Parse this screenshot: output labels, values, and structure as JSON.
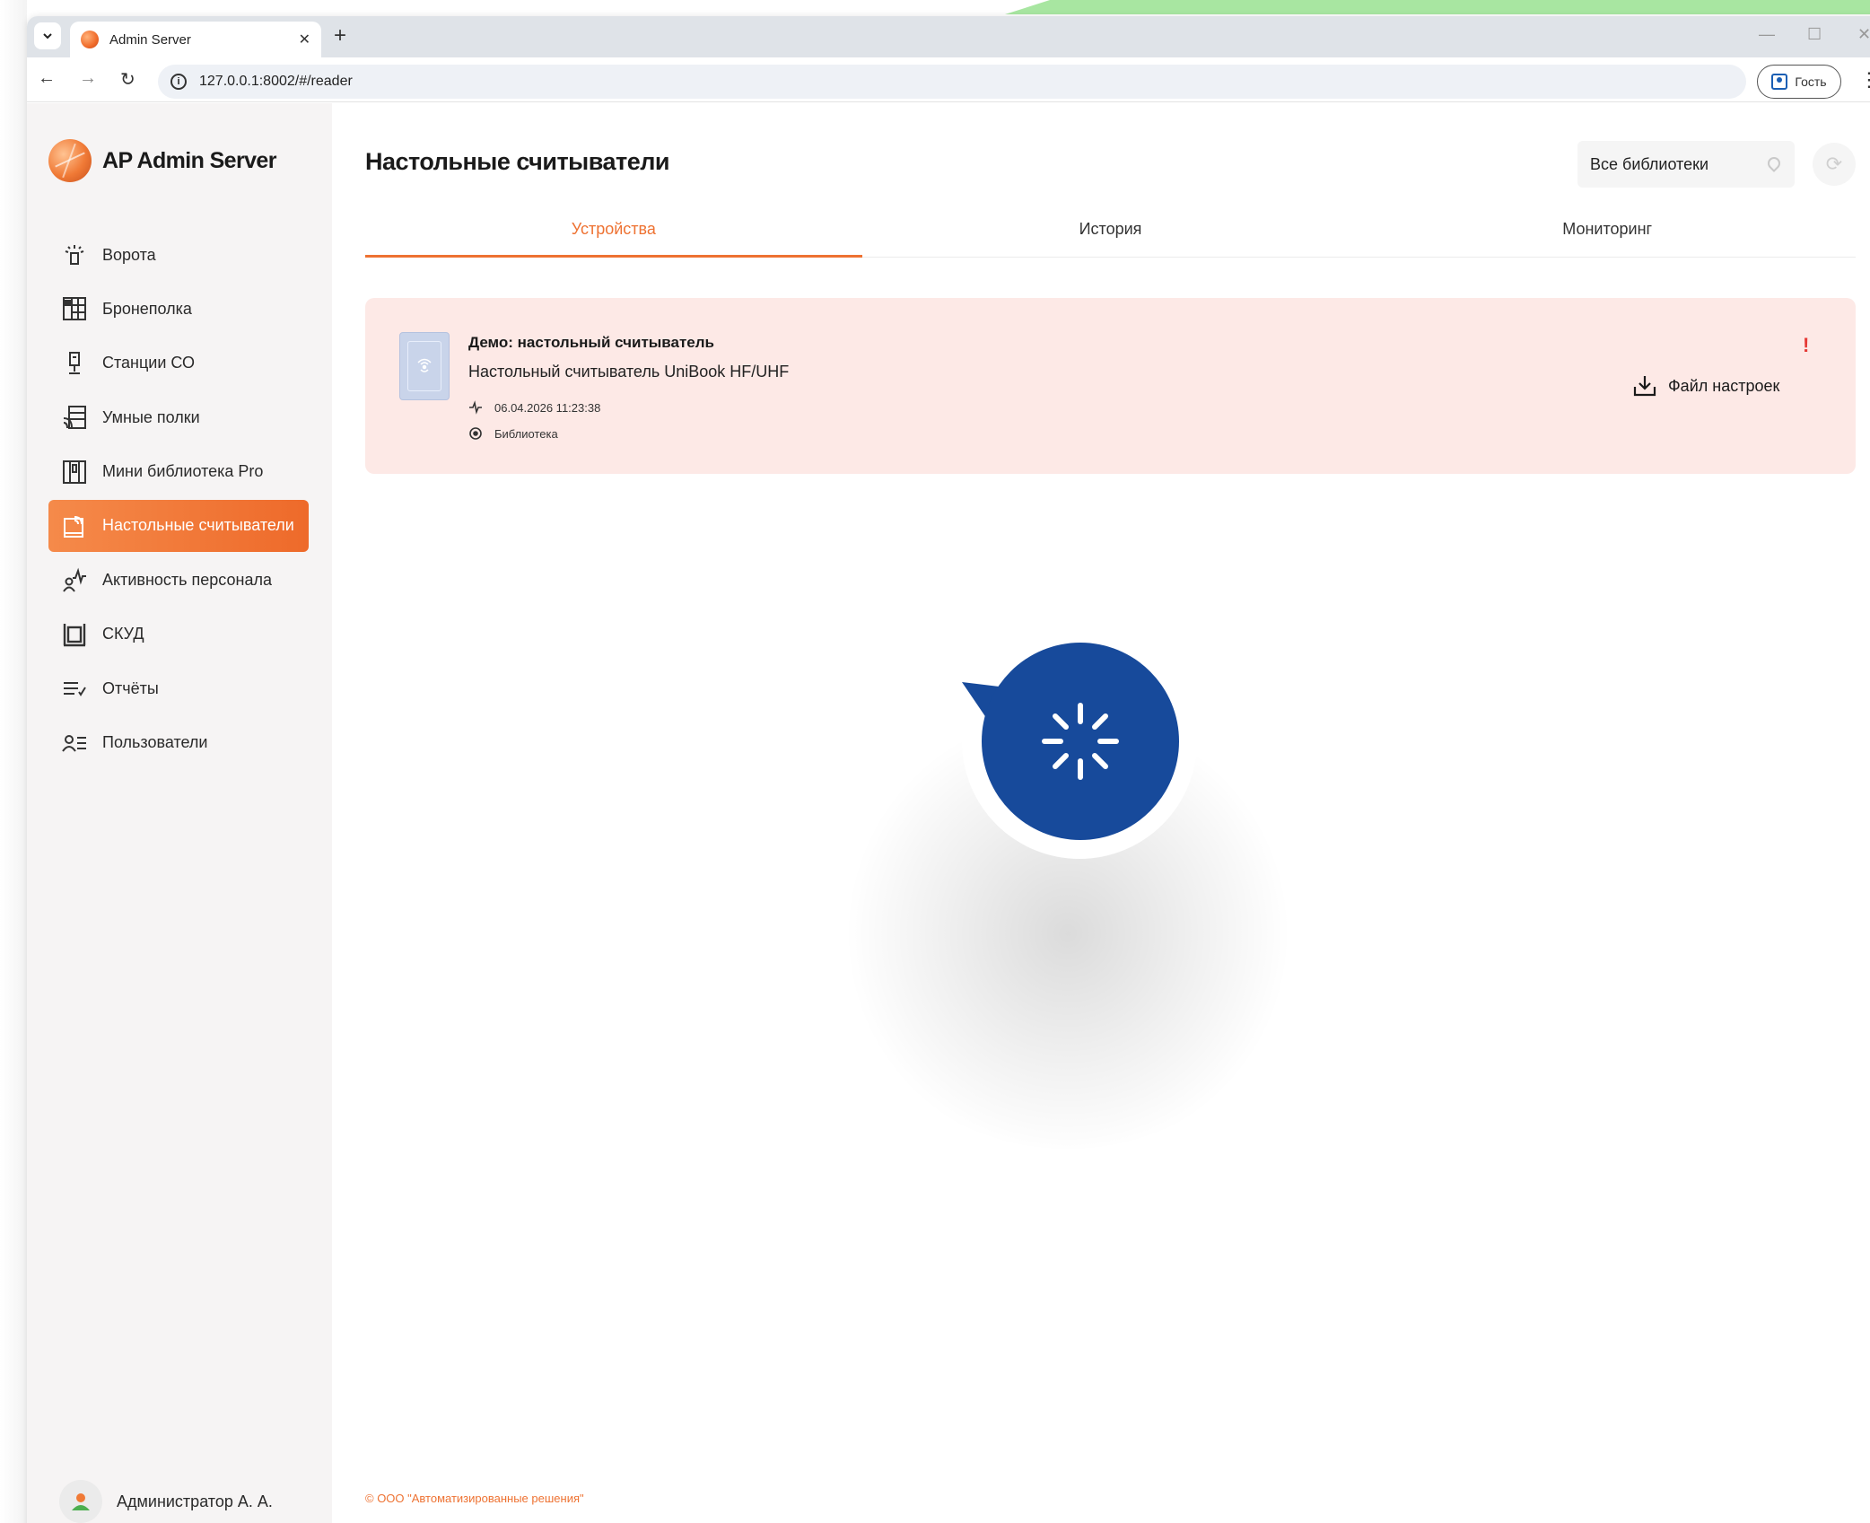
{
  "browser": {
    "tab_title": "Admin Server",
    "tab_close": "✕",
    "new_tab": "+",
    "url": "127.0.0.1:8002/#/reader",
    "guest_label": "Гость"
  },
  "app": {
    "brand": "AP Admin Server",
    "nav": [
      {
        "label": "Ворота",
        "icon": "gate-light-icon",
        "active": false
      },
      {
        "label": "Бронеполка",
        "icon": "locker-grid-icon",
        "active": false
      },
      {
        "label": "Станции СО",
        "icon": "station-kiosk-icon",
        "active": false
      },
      {
        "label": "Умные полки",
        "icon": "smart-shelf-icon",
        "active": false
      },
      {
        "label": "Мини библиотека Pro",
        "icon": "mini-library-icon",
        "active": false
      },
      {
        "label": "Настольные считыватели",
        "icon": "desktop-reader-icon",
        "active": true
      },
      {
        "label": "Активность персонала",
        "icon": "staff-activity-icon",
        "active": false
      },
      {
        "label": "СКУД",
        "icon": "access-control-icon",
        "active": false
      },
      {
        "label": "Отчёты",
        "icon": "reports-icon",
        "active": false
      },
      {
        "label": "Пользователи",
        "icon": "users-icon",
        "active": false
      }
    ],
    "user_name": "Администратор А. А.",
    "page_title": "Настольные считыватели",
    "library_select": "Все библиотеки",
    "tabs": [
      {
        "label": "Устройства",
        "active": true
      },
      {
        "label": "История",
        "active": false
      },
      {
        "label": "Мониторинг",
        "active": false
      }
    ],
    "device": {
      "name": "Демо: настольный считыватель",
      "model": "Настольный считыватель UniBook HF/UHF",
      "last_activity": "06.04.2026 11:23:38",
      "location": "Библиотека",
      "alert": "!",
      "settings_file": "Файл настроек"
    },
    "copyright": "© ООО \"Автоматизированные решения\""
  },
  "colors": {
    "accent": "#ee7232",
    "card_alert_bg": "#fde9e6",
    "loader": "#174a9b"
  }
}
